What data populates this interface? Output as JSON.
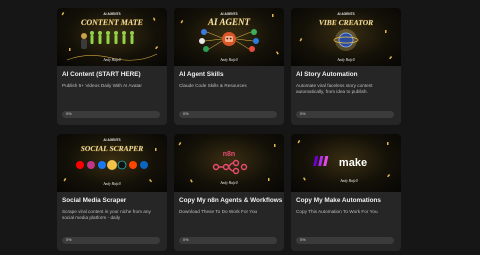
{
  "courses": [
    {
      "badge": "AI AGENTS",
      "banner": "CONTENT MATE",
      "signature": "Andy Hafell",
      "title": "AI Content (START HERE)",
      "description": "Publish 5+ Videos Daily With AI Avatar",
      "progress": "0%",
      "progress_value": 0,
      "icon": "avatar-clones-icon"
    },
    {
      "badge": "AI AGENTS",
      "banner": "AI AGENT",
      "signature": "Andy Hafell",
      "title": "AI Agent Skills",
      "description": "Claude Code Skills & Resources",
      "progress": "0%",
      "progress_value": 0,
      "icon": "app-integrations-icon"
    },
    {
      "badge": "AI AGENTS",
      "banner": "VIBE CREATOR",
      "signature": "Andy Hafell",
      "title": "AI Story Automation",
      "description": "Automate viral faceless story content automatically, from idea to publish.",
      "progress": "0%",
      "progress_value": 0,
      "icon": "planet-icon"
    },
    {
      "badge": "AI AGENTS",
      "banner": "SOCIAL SCRAPER",
      "signature": "Andy Hafell",
      "title": "Social Media Scraper",
      "description": "Scrape viral content in your niche from any social media platform - daily",
      "progress": "0%",
      "progress_value": 0,
      "icon": "social-logos-icon"
    },
    {
      "badge": "",
      "banner": "",
      "signature": "Andy Hafell",
      "title": "Copy My n8n Agents & Workflows",
      "description": "Download These To Do Work For You",
      "progress": "0%",
      "progress_value": 0,
      "icon": "n8n-logo-icon"
    },
    {
      "badge": "",
      "banner": "make",
      "signature": "Andy Hafell",
      "title": "Copy My Make Automations",
      "description": "Copy This Automation To Work For You",
      "progress": "0%",
      "progress_value": 0,
      "icon": "make-logo-icon"
    }
  ],
  "colors": {
    "page_bg": "#161616",
    "card_bg": "#262626",
    "gold": "#e3b84a",
    "progress_track": "#3b3b3b"
  }
}
